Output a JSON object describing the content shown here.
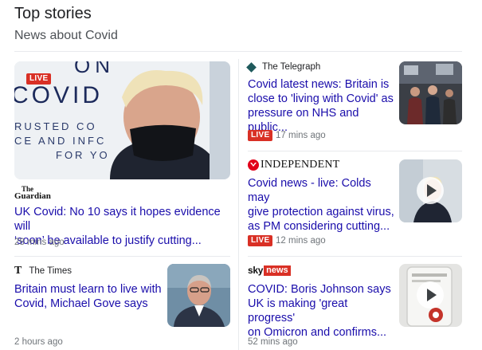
{
  "section": {
    "title": "Top stories",
    "subtitle": "News about Covid"
  },
  "stories": [
    {
      "source": "The Guardian",
      "source_line1": "The",
      "source_line2": "Guardian",
      "headline_lines": [
        "UK Covid: No 10 says it hopes evidence will",
        "‘soon’ be available to justify cutting..."
      ],
      "time": "28 mins ago",
      "live_label": "LIVE",
      "image_text": [
        "ON",
        "COVID",
        "RUSTED CO",
        "CE AND INFC",
        "FOR YO"
      ]
    },
    {
      "source": "The Telegraph",
      "headline_lines": [
        "Covid latest news: Britain is",
        "close to 'living with Covid' as",
        "pressure on NHS and public..."
      ],
      "live_label": "LIVE",
      "time": "17 mins ago"
    },
    {
      "source": "INDEPENDENT",
      "headline_lines": [
        "Covid news - live: Colds may",
        "give protection against virus,",
        "as PM considering cutting..."
      ],
      "live_label": "LIVE",
      "time": "12 mins ago"
    },
    {
      "source": "The Times",
      "source_badge": "T",
      "headline_lines": [
        "Britain must learn to live with",
        "Covid, Michael Gove says"
      ],
      "time": "2 hours ago"
    },
    {
      "source_sky": "sky",
      "source_news": "news",
      "headline_lines": [
        "COVID: Boris Johnson says",
        "UK is making 'great progress'",
        "on Omicron and confirms..."
      ],
      "time": "52 mins ago"
    }
  ],
  "colors": {
    "link": "#1a0dab",
    "live": "#d93025",
    "meta": "#70757a",
    "divider": "#e8eaed"
  }
}
